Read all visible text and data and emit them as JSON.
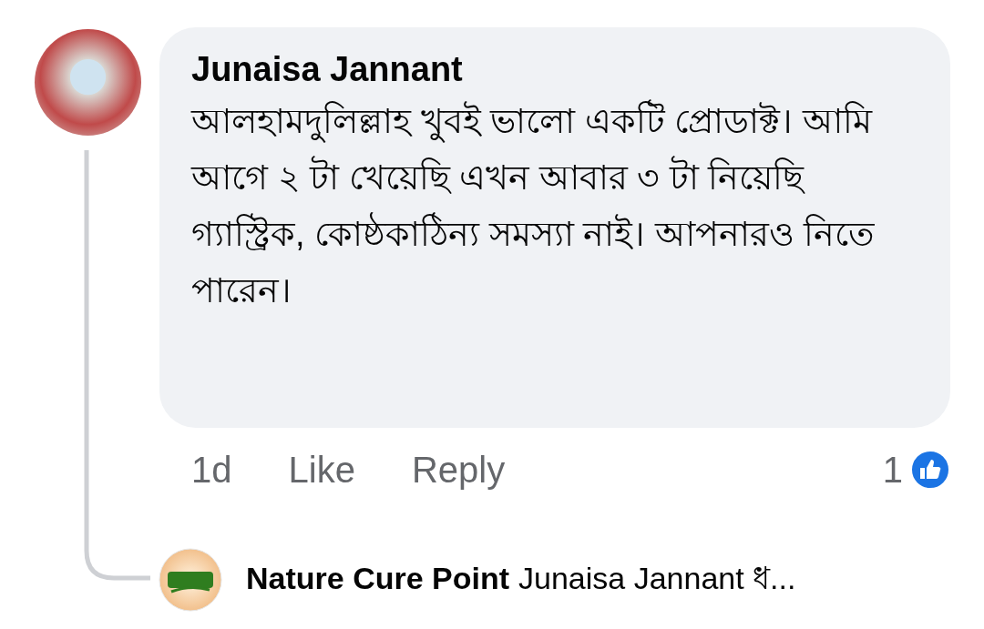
{
  "comment": {
    "author": "Junaisa Jannant",
    "text": "আলহামদুলিল্লাহ খুবই ভালো একটি প্রোডাক্ট। আমি আগে ২ টা খেয়েছি এখন আবার ৩ টা নিয়েছি গ্যাস্ট্রিক, কোষ্ঠকাঠিন্য সমস্যা নাই। আপনারও নিতে পারেন।",
    "time": "1d",
    "actions": [
      "Like",
      "Reply"
    ],
    "reaction_count": "1"
  },
  "reply": {
    "author": "Nature Cure Point",
    "preview": "Junaisa Jannant ধ..."
  }
}
